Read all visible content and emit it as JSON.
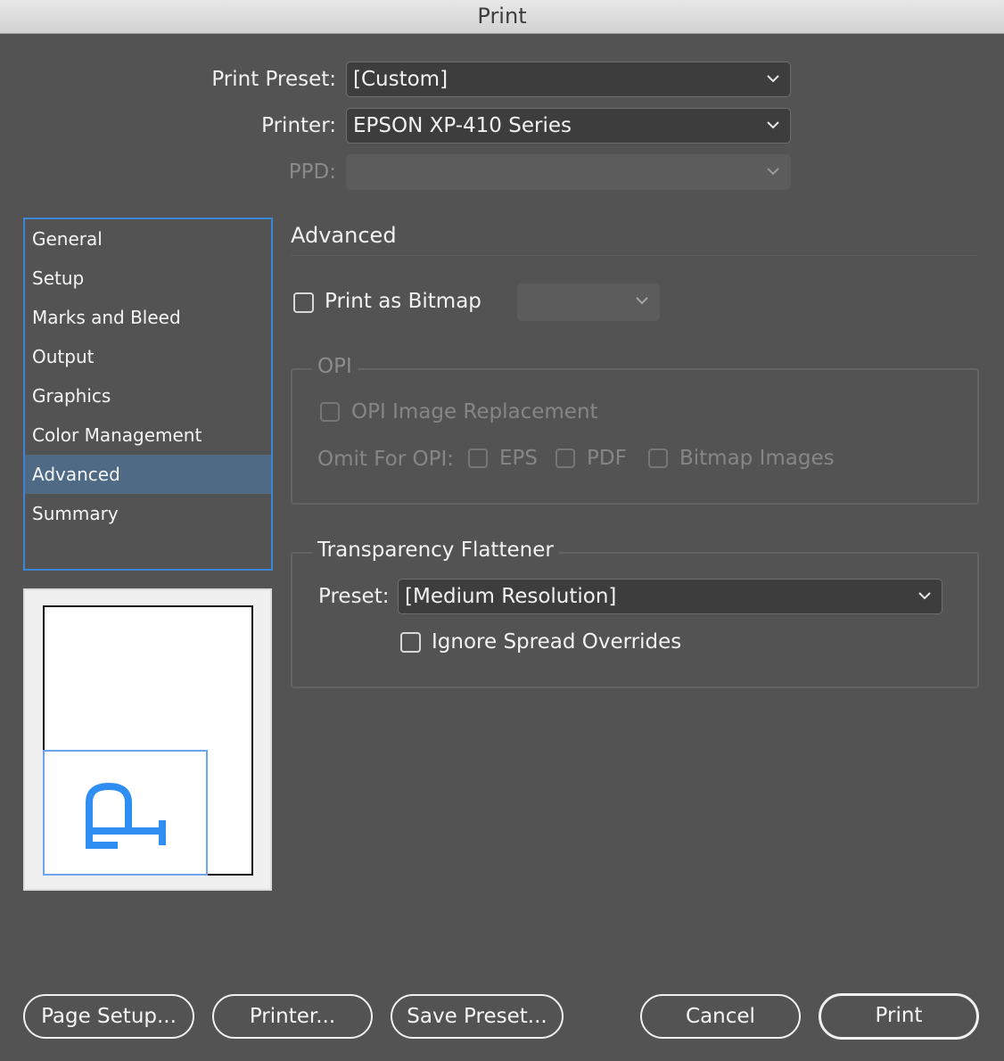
{
  "window": {
    "title": "Print"
  },
  "print_preset": {
    "label": "Print Preset:",
    "value": "[Custom]"
  },
  "printer": {
    "label": "Printer:",
    "value": "EPSON XP-410 Series"
  },
  "ppd": {
    "label": "PPD:",
    "value": ""
  },
  "sidebar": {
    "items": [
      {
        "label": "General"
      },
      {
        "label": "Setup"
      },
      {
        "label": "Marks and Bleed"
      },
      {
        "label": "Output"
      },
      {
        "label": "Graphics"
      },
      {
        "label": "Color Management"
      },
      {
        "label": "Advanced",
        "selected": true
      },
      {
        "label": "Summary"
      }
    ]
  },
  "preview": {
    "glyph": "P",
    "accent_color": "#2f8ef2"
  },
  "advanced": {
    "title": "Advanced",
    "print_as_bitmap": {
      "label": "Print as Bitmap",
      "checked": false,
      "dropdown_value": ""
    },
    "opi": {
      "title": "OPI",
      "image_replacement": {
        "label": "OPI Image Replacement",
        "checked": false
      },
      "omit_label": "Omit For OPI:",
      "omit_options": [
        {
          "label": "EPS",
          "checked": false
        },
        {
          "label": "PDF",
          "checked": false
        },
        {
          "label": "Bitmap Images",
          "checked": false
        }
      ]
    },
    "transparency": {
      "title": "Transparency Flattener",
      "preset_label": "Preset:",
      "preset_value": "[Medium Resolution]",
      "ignore_overrides": {
        "label": "Ignore Spread Overrides",
        "checked": false
      }
    }
  },
  "buttons": {
    "page_setup": "Page Setup...",
    "printer": "Printer...",
    "save_preset": "Save Preset...",
    "cancel": "Cancel",
    "print": "Print"
  },
  "colors": {
    "background": "#535353",
    "selection": "#4e6a85",
    "focus_border": "#3d86d6"
  }
}
